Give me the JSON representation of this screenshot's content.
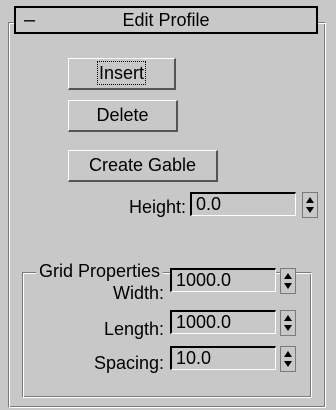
{
  "rollout": {
    "collapse_symbol": "–",
    "title": "Edit Profile"
  },
  "buttons": {
    "insert": "Insert",
    "delete": "Delete",
    "create_gable": "Create Gable"
  },
  "height": {
    "label": "Height:",
    "value": "0.0"
  },
  "grid_properties": {
    "legend": "Grid Properties",
    "width": {
      "label": "Width:",
      "value": "1000.0"
    },
    "length": {
      "label": "Length:",
      "value": "1000.0"
    },
    "spacing": {
      "label": "Spacing:",
      "value": "10.0"
    }
  },
  "icons": {
    "spinner": "up-down-arrows"
  }
}
